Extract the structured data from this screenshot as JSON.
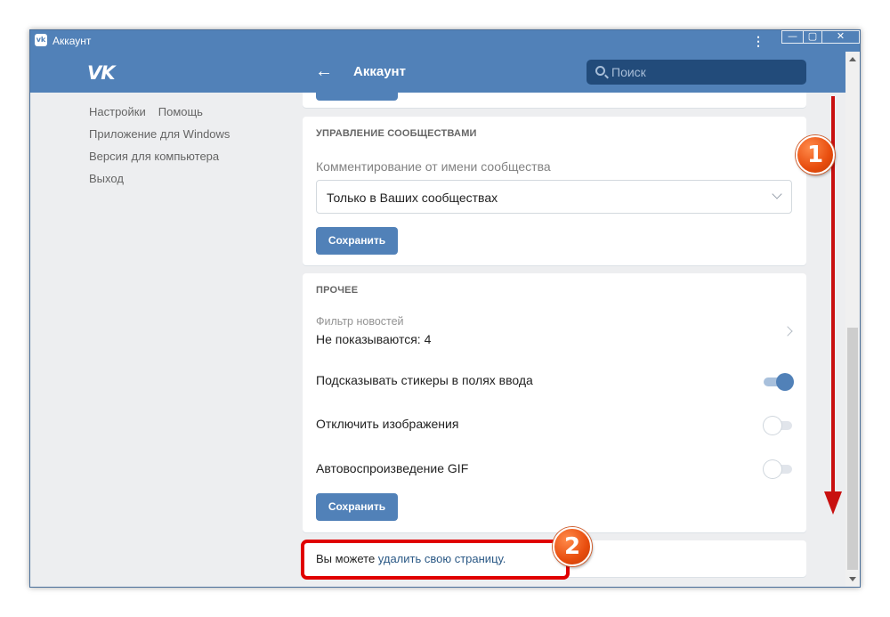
{
  "window": {
    "title": "Аккаунт",
    "app_icon": "vk-icon",
    "controls": {
      "minimize": "—",
      "maximize": "▢",
      "close": "✕"
    }
  },
  "header": {
    "logo": "VK",
    "back_icon": "←",
    "page_title": "Аккаунт",
    "search_placeholder": "Поиск"
  },
  "sidebar": {
    "items": [
      {
        "label": "Настройки"
      },
      {
        "label": "Помощь"
      },
      {
        "label": "Приложение для Windows"
      },
      {
        "label": "Версия для компьютера"
      },
      {
        "label": "Выход"
      }
    ]
  },
  "communities": {
    "heading": "УПРАВЛЕНИЕ СООБЩЕСТВАМИ",
    "comment_label": "Комментирование от имени сообщества",
    "comment_value": "Только в Ваших сообществах",
    "save_label": "Сохранить"
  },
  "other": {
    "heading": "ПРОЧЕЕ",
    "news_filter_label": "Фильтр новостей",
    "news_filter_value": "Не показываются: 4",
    "stickers_label": "Подсказывать стикеры в полях ввода",
    "stickers_on": true,
    "images_label": "Отключить изображения",
    "images_on": false,
    "gif_label": "Автовоспроизведение GIF",
    "gif_on": false,
    "save_label": "Сохранить"
  },
  "delete": {
    "prefix": "Вы можете ",
    "link": "удалить свою страницу."
  },
  "annotations": {
    "step1": "1",
    "step2": "2",
    "marker_color": "#e00000"
  },
  "colors": {
    "brand": "#5181b8",
    "link": "#2a5885",
    "background": "#edeef0"
  }
}
